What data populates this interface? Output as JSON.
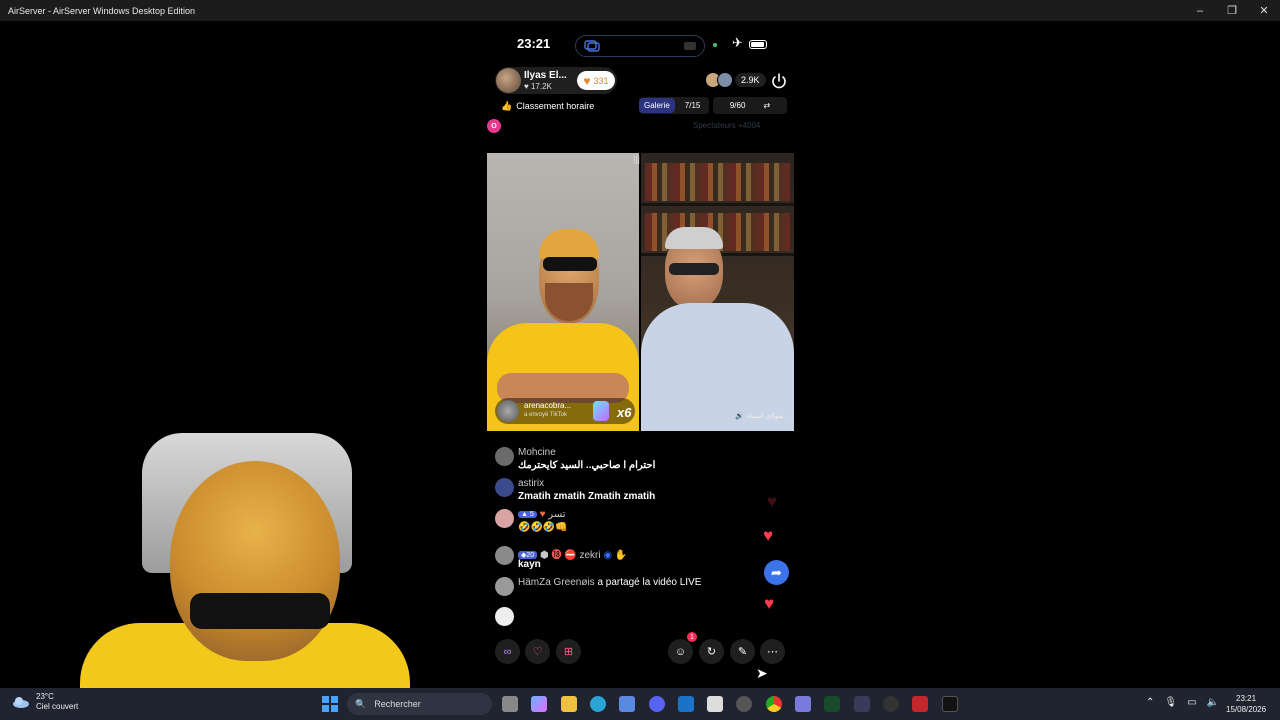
{
  "window": {
    "title": "AirServer - AirServer Windows Desktop Edition"
  },
  "phone": {
    "status_time": "23:21",
    "host": {
      "name": "Ilyas El...",
      "likes": "17.2K",
      "heart_count": "331"
    },
    "viewer_count": "2.9K",
    "ranking_label": "Classement horaire",
    "gallery_label": "Galerie",
    "gallery_value": "7/15",
    "counter_value": "9/60",
    "sponsor_text": "Spectateurs +4004",
    "badge_letter": "O",
    "gift": {
      "sender": "arenacobra...",
      "subtitle": "a envoyé TikTok",
      "multiplier": "x6"
    },
    "guest_label": "مولاي اسماء...",
    "chat": [
      {
        "user": "Mohcine",
        "text": "احترام ا صاحبي.. السيد كايحترمك",
        "avatar_color": "#6b6b6b"
      },
      {
        "user": "astirix",
        "text": "Zmatih zmatih Zmatih zmatih",
        "avatar_color": "#3a4a8c"
      },
      {
        "user": "تسر",
        "level": "5",
        "text": "🤣🤣🤣👊",
        "avatar_color": "#d9a3a3"
      },
      {
        "user": "zekri",
        "level": "20",
        "text": "kayn",
        "avatar_color": "#8a8a8a"
      },
      {
        "user": "HämZa Greenøis",
        "text": "a partagé la vidéo LIVE",
        "avatar_color": "#9a9a9a"
      }
    ],
    "notification_count": "1",
    "icons": [
      "link-icon",
      "heart-link-icon",
      "grid-icon",
      "comment-icon",
      "share-icon",
      "magic-wand-icon",
      "more-icon"
    ]
  },
  "taskbar": {
    "temperature": "23°C",
    "weather_desc": "Ciel couvert",
    "search_placeholder": "Rechercher",
    "time": "23:21",
    "date": "15/08/2026"
  }
}
